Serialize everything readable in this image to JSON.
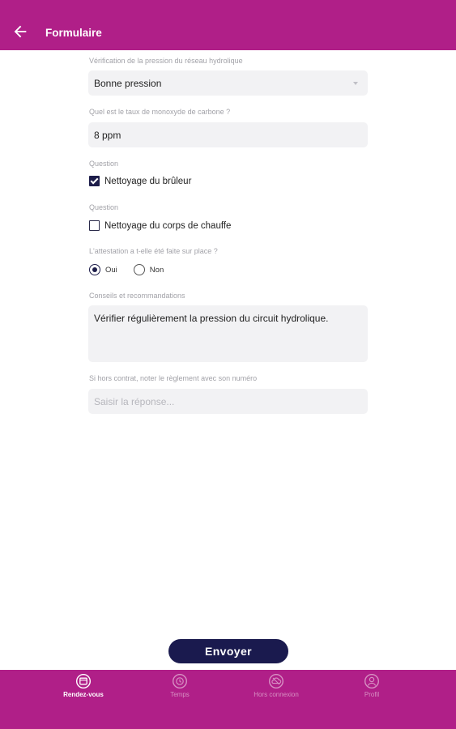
{
  "header": {
    "title": "Formulaire"
  },
  "form": {
    "q1": {
      "label": "Vérification de la pression du réseau hydrolique",
      "value": "Bonne pression"
    },
    "q2": {
      "label": "Quel est le taux de monoxyde de carbone ?",
      "value": "8 ppm"
    },
    "q3": {
      "label": "Question",
      "option": "Nettoyage du brûleur",
      "checked": true
    },
    "q4": {
      "label": "Question",
      "option": "Nettoyage du corps de chauffe",
      "checked": false
    },
    "q5": {
      "label": "L'attestation a t-elle été faite sur place ?",
      "options": [
        "Oui",
        "Non"
      ],
      "selected": "Oui"
    },
    "q6": {
      "label": "Conseils et recommandations",
      "value": "Vérifier régulièrement la pression du circuit hydrolique."
    },
    "q7": {
      "label": "Si hors contrat, noter le règlement avec son numéro",
      "placeholder": "Saisir la réponse..."
    }
  },
  "submit_label": "Envoyer",
  "nav": [
    {
      "label": "Rendez-vous",
      "icon": "calendar-icon",
      "active": true
    },
    {
      "label": "Temps",
      "icon": "clock-icon",
      "active": false
    },
    {
      "label": "Hors connexion",
      "icon": "cloud-offline-icon",
      "active": false
    },
    {
      "label": "Profil",
      "icon": "profile-icon",
      "active": false
    }
  ],
  "colors": {
    "brand": "#b01f88",
    "accent": "#1a1a4e",
    "field_bg": "#f2f2f4"
  }
}
